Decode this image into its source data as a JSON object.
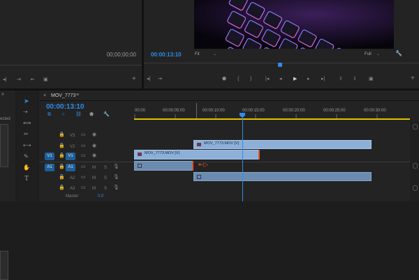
{
  "source_monitor": {
    "timecode": "00;00;00;00"
  },
  "program_monitor": {
    "timecode": "00:00:13:10",
    "fit_label": "Fit",
    "full_label": "Full"
  },
  "left_panel": {
    "partial_text": "ected"
  },
  "timeline": {
    "tab_label": "MOV_7773",
    "timecode": "00:00:13:10",
    "ruler": [
      "00:00",
      "00:00:05:00",
      "00:00:10:00",
      "00:00:15:00",
      "00:00:20:00",
      "00:00:25:00",
      "00:00:30:00"
    ],
    "video_tracks": [
      "V3",
      "V2",
      "V1"
    ],
    "audio_tracks": [
      "A1",
      "A2",
      "A3"
    ],
    "source_v": "V1",
    "source_a": "A1",
    "master_label": "Master",
    "master_value": "0.0",
    "clips": {
      "v2_label": "MOV_7773.MOV [V]",
      "v1_label": "MOV_7773.MOV [V]"
    }
  },
  "colors": {
    "timecode_blue": "#2d8ceb",
    "video_clip": "#8db0d9",
    "audio_clip": "#6c8bb1",
    "work_area": "#e5c100",
    "playhead": "#2d8ceb",
    "clip_edge": "#e0522f"
  }
}
